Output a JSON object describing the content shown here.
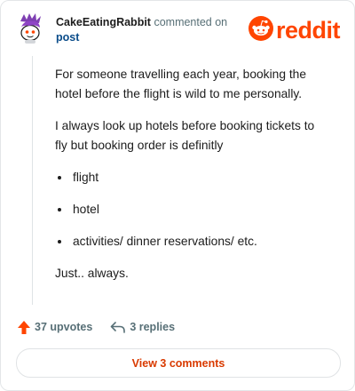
{
  "colors": {
    "brand": "#ff4500",
    "link": "#0a4c8a",
    "text": "#1c1c1c",
    "muted": "#576f76",
    "button_text": "#d93a00"
  },
  "comment": {
    "author": "CakeEatingRabbit",
    "action_text": "commented on",
    "target": "post",
    "avatar_icon": "purple-haired-snoo-avatar-icon",
    "paragraph_1": "For someone travelling each year, booking the hotel before the flight is wild to me personally.",
    "paragraph_2": "I always look up hotels before booking tickets to fly but booking order is definitly",
    "list_items": [
      "flight",
      "hotel",
      "activities/ dinner reservations/ etc."
    ],
    "paragraph_3": "Just.. always."
  },
  "brand": {
    "name": "reddit",
    "logo_icon": "reddit-snoo-logo-icon"
  },
  "actions": {
    "upvotes_label": "37 upvotes",
    "upvote_icon": "upvote-arrow-icon",
    "replies_label": "3 replies",
    "reply_icon": "reply-arrow-icon"
  },
  "footer": {
    "view_comments_label": "View 3 comments"
  }
}
